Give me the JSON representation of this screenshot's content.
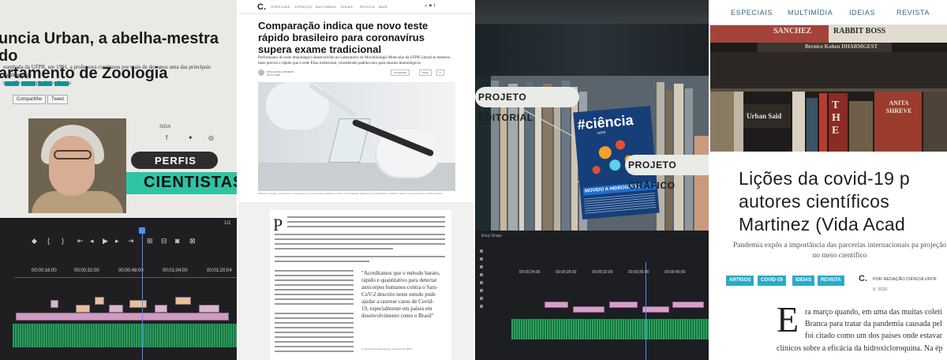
{
  "panel1": {
    "headline": "uncia Urban, a abelha-mestra do\nartamento de Zoologia",
    "lead": "esenhada da UFPR, em 1991, a professora continuou por mais de dez anos uma das principais catalogadora\ns região neotropical do planeta",
    "share_button": "Compartilhe",
    "tweet_button": "Tweet",
    "follow_label": "SIGA",
    "social_icons": [
      "facebook-icon",
      "twitter-icon",
      "instagram-icon"
    ],
    "badge_top": "PERFIS",
    "badge_bottom": "CIENTISTAS",
    "counter": "1/2",
    "timecodes": [
      "00;00;16;00",
      "00;00;32;00",
      "00;00;48;00",
      "00;01;04;00",
      "00;01;20;04"
    ],
    "accent": "#2ec3a2"
  },
  "panel2": {
    "logo": "C.",
    "nav": [
      "ESPECIAIS",
      "ESPAÇOS",
      "MULTIMÍDIA",
      "IDEIAS",
      "REVISTA",
      "MAIS"
    ],
    "title": "Comparação indica que novo teste rápido brasileiro para coronavírus supera exame tradicional",
    "subtitle": "Performance do teste imunológico desenvolvido no Laboratório de Microbiologia Molecular da UFPR Litoral se mostrou mais preciso e rápido que o teste Elisa tradicional, considerado padrão-ouro para ensaios imunológicos",
    "byline": "POR CAMILLA RONDON",
    "date": "30 JUL 2020",
    "share": "Compartilhe",
    "tweet": "Tweet",
    "photo_caption": "Método é inovador, permitindo o emprego de um Imunoensaio acoplado à matriz de Cerrado/gel ajudando os profissionais a realizar o Suave Cova para cerca de 200 amostras",
    "dropcap": "P",
    "quote": "\"Acreditamos que o método barato, rápido e quantitativo para detectar anticorpos humanos contra o Sars-CoV-2 descrito neste estudo pode ajudar a rastrear casos de Covid-19, especialmente em países em desenvolvimento como o Brasil\"",
    "quote_credit": "Luciano Fernandes Huergo, professor da UFPR"
  },
  "panel3": {
    "label_top": "PROJETO EDITORIAL",
    "label_right": "PROJETO GRÁFICO",
    "magazine_title": "#ciência",
    "magazine_sub": "UFPR",
    "magazine_cover_line": "MOVIDO A HIDROGÊNIO",
    "sequence_label": "Envy Drops",
    "timecodes": [
      "00;00;24;00",
      "00;00;28;00",
      "00;00;32;00",
      "00;00;36;00",
      "00;00;40;00"
    ]
  },
  "panel4": {
    "nav": [
      "ESPECIAIS",
      "MULTIMÍDIA",
      "IDEIAS",
      "REVISTA"
    ],
    "spines": [
      "SANCHEZ",
      "RABBIT BOSS",
      "Bernice Kohen DHARMGEST",
      "Urban Said",
      "THE",
      "ANITA SHREVE"
    ],
    "title": "Lições da covid-19 p autores científicos Martinez (Vida Acad",
    "dek": "Pandemia expôs a importância das parcerias internacionais pa projeção no meio científico",
    "tags": [
      "ARTIGOS",
      "COVID-19",
      "IDEIAS",
      "REVISTA"
    ],
    "byline_logo": "C.",
    "byline": "POR REDAÇÃO CIÊNCIA UFPR",
    "date": "8, 2020",
    "dropcap": "E",
    "body_lines": [
      "ra março quando, em uma das muitas coleti",
      "Branca para tratar da pandemia causada pel",
      "foi citado como um dos países onde estavar"
    ],
    "body_last": "clínicos sobre a eficácia da hidroxicloroquina. Na ép",
    "tag_color": "#2ba9c9"
  }
}
